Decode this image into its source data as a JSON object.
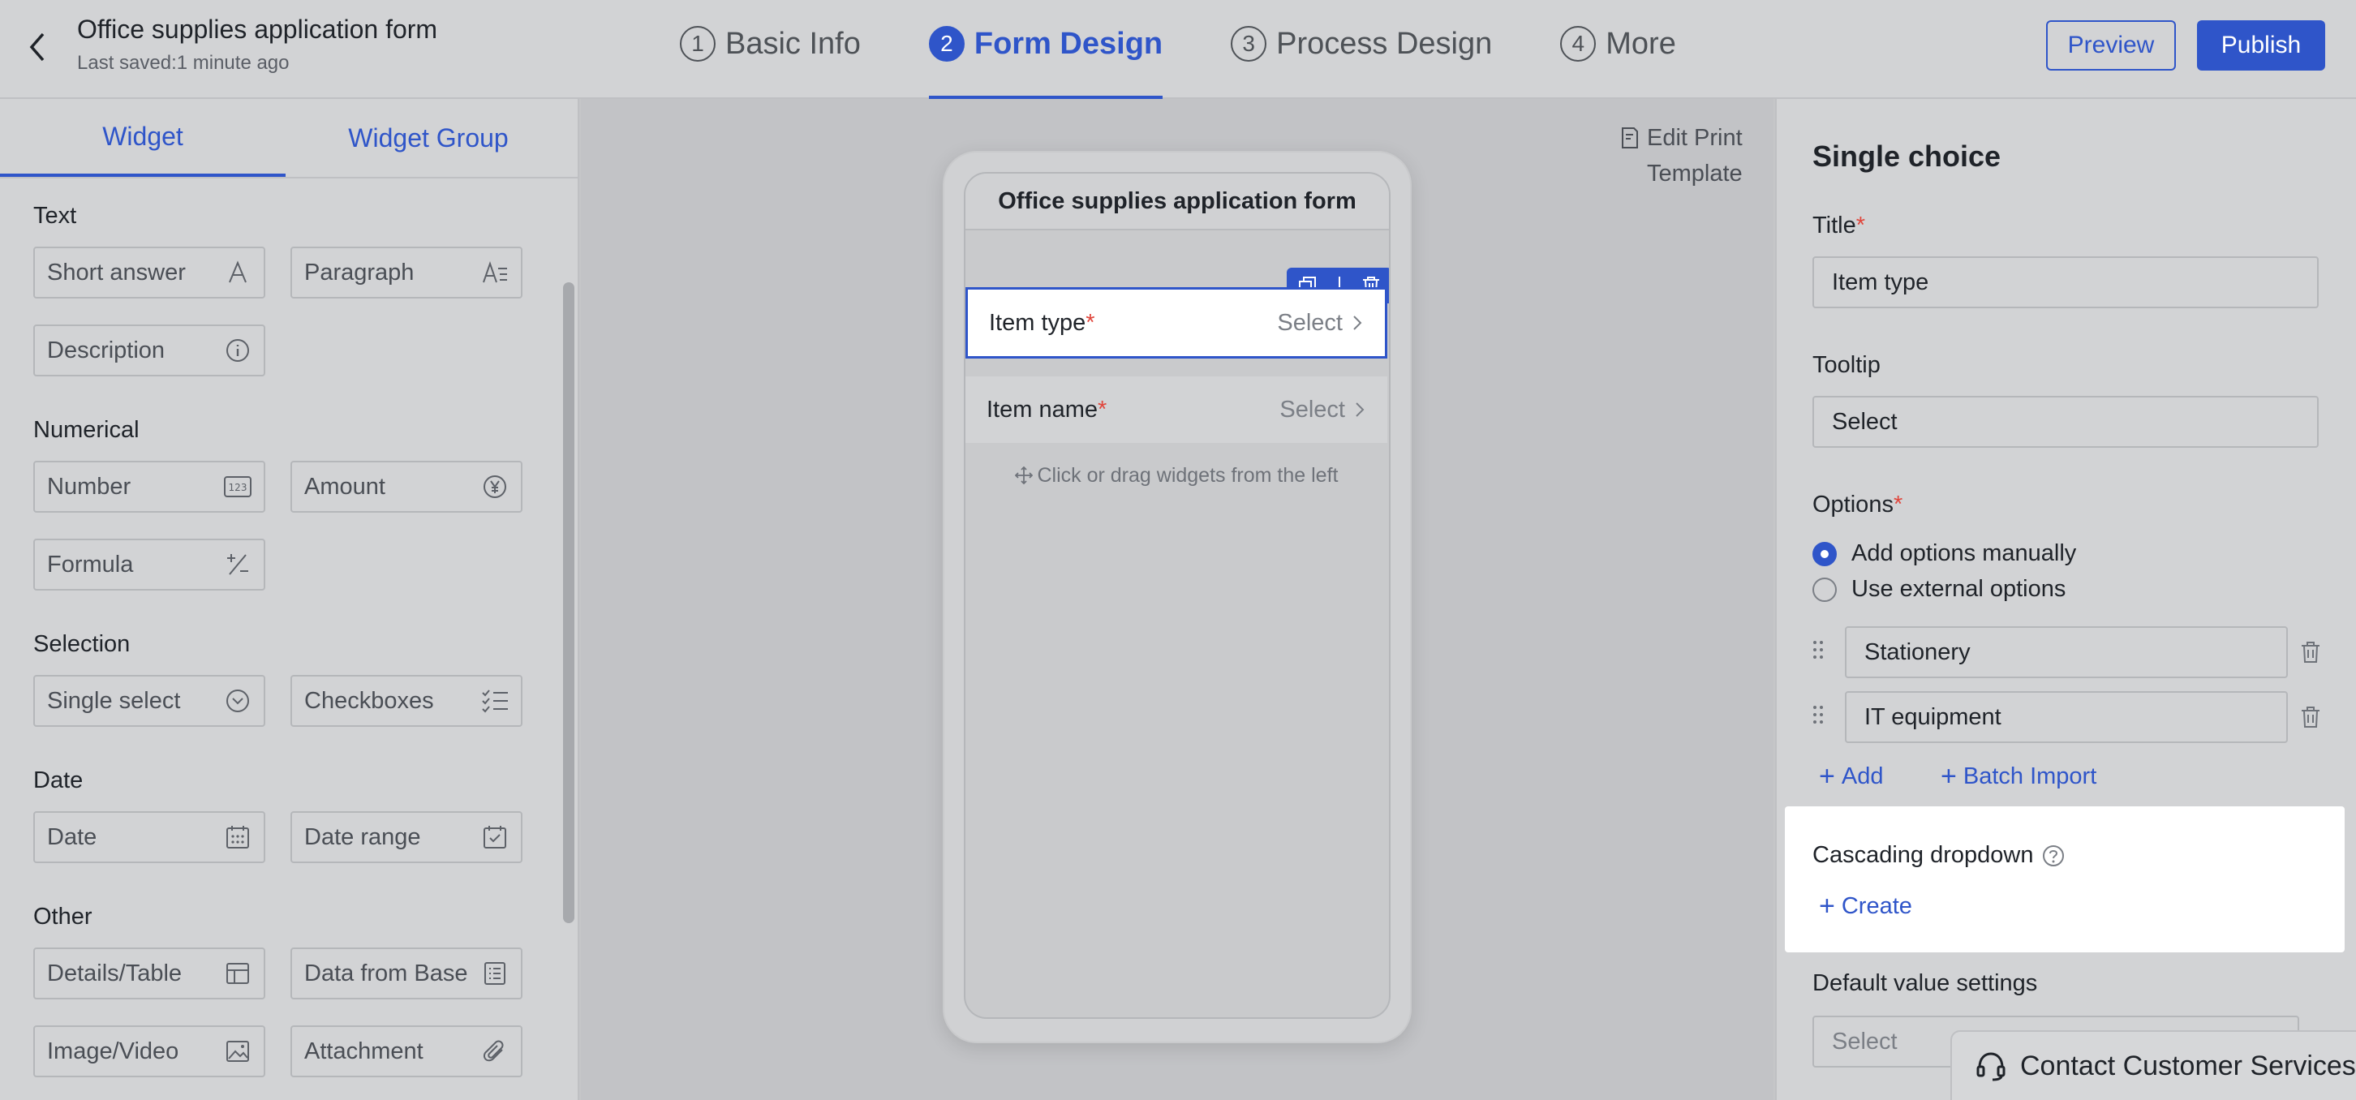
{
  "header": {
    "back_icon": "chevron-left-icon",
    "title": "Office supplies application form",
    "saved": "Last saved:1 minute ago",
    "steps": [
      {
        "num": "1",
        "label": "Basic Info"
      },
      {
        "num": "2",
        "label": "Form Design"
      },
      {
        "num": "3",
        "label": "Process Design"
      },
      {
        "num": "4",
        "label": "More"
      }
    ],
    "active_step": "Form Design",
    "preview": "Preview",
    "publish": "Publish"
  },
  "left": {
    "tabs": [
      "Widget",
      "Widget Group"
    ],
    "groups": {
      "text": "Text",
      "numerical": "Numerical",
      "selection": "Selection",
      "date": "Date",
      "other": "Other"
    },
    "widgets": {
      "short_answer": "Short answer",
      "paragraph": "Paragraph",
      "description": "Description",
      "number": "Number",
      "amount": "Amount",
      "formula": "Formula",
      "single_select": "Single select",
      "checkboxes": "Checkboxes",
      "date": "Date",
      "date_range": "Date range",
      "details_table": "Details/Table",
      "data_from_base": "Data from Base",
      "image_video": "Image/Video",
      "attachment": "Attachment"
    }
  },
  "canvas": {
    "edit_print_line1": "Edit Print",
    "edit_print_line2": "Template",
    "form_title": "Office supplies application form",
    "fields": [
      {
        "label": "Item type",
        "required": "*",
        "placeholder": "Select"
      },
      {
        "label": "Item name",
        "required": "*",
        "placeholder": "Select"
      }
    ],
    "hint": "Click or drag widgets from the left"
  },
  "right": {
    "heading": "Single choice",
    "title_label": "Title",
    "title_value": "Item type",
    "tooltip_label": "Tooltip",
    "tooltip_value": "Select",
    "options_label": "Options",
    "required_mark": "*",
    "radio_manual": "Add options manually",
    "radio_external": "Use external options",
    "options": [
      "Stationery",
      "IT equipment"
    ],
    "add": "Add",
    "batch_import": "Batch Import",
    "cascading_label": "Cascading dropdown",
    "create": "Create",
    "default_label": "Default value settings",
    "default_placeholder": "Select",
    "contact": "Contact Customer Services"
  },
  "colors": {
    "accent": "#2f55c9",
    "required": "#e0463c"
  }
}
